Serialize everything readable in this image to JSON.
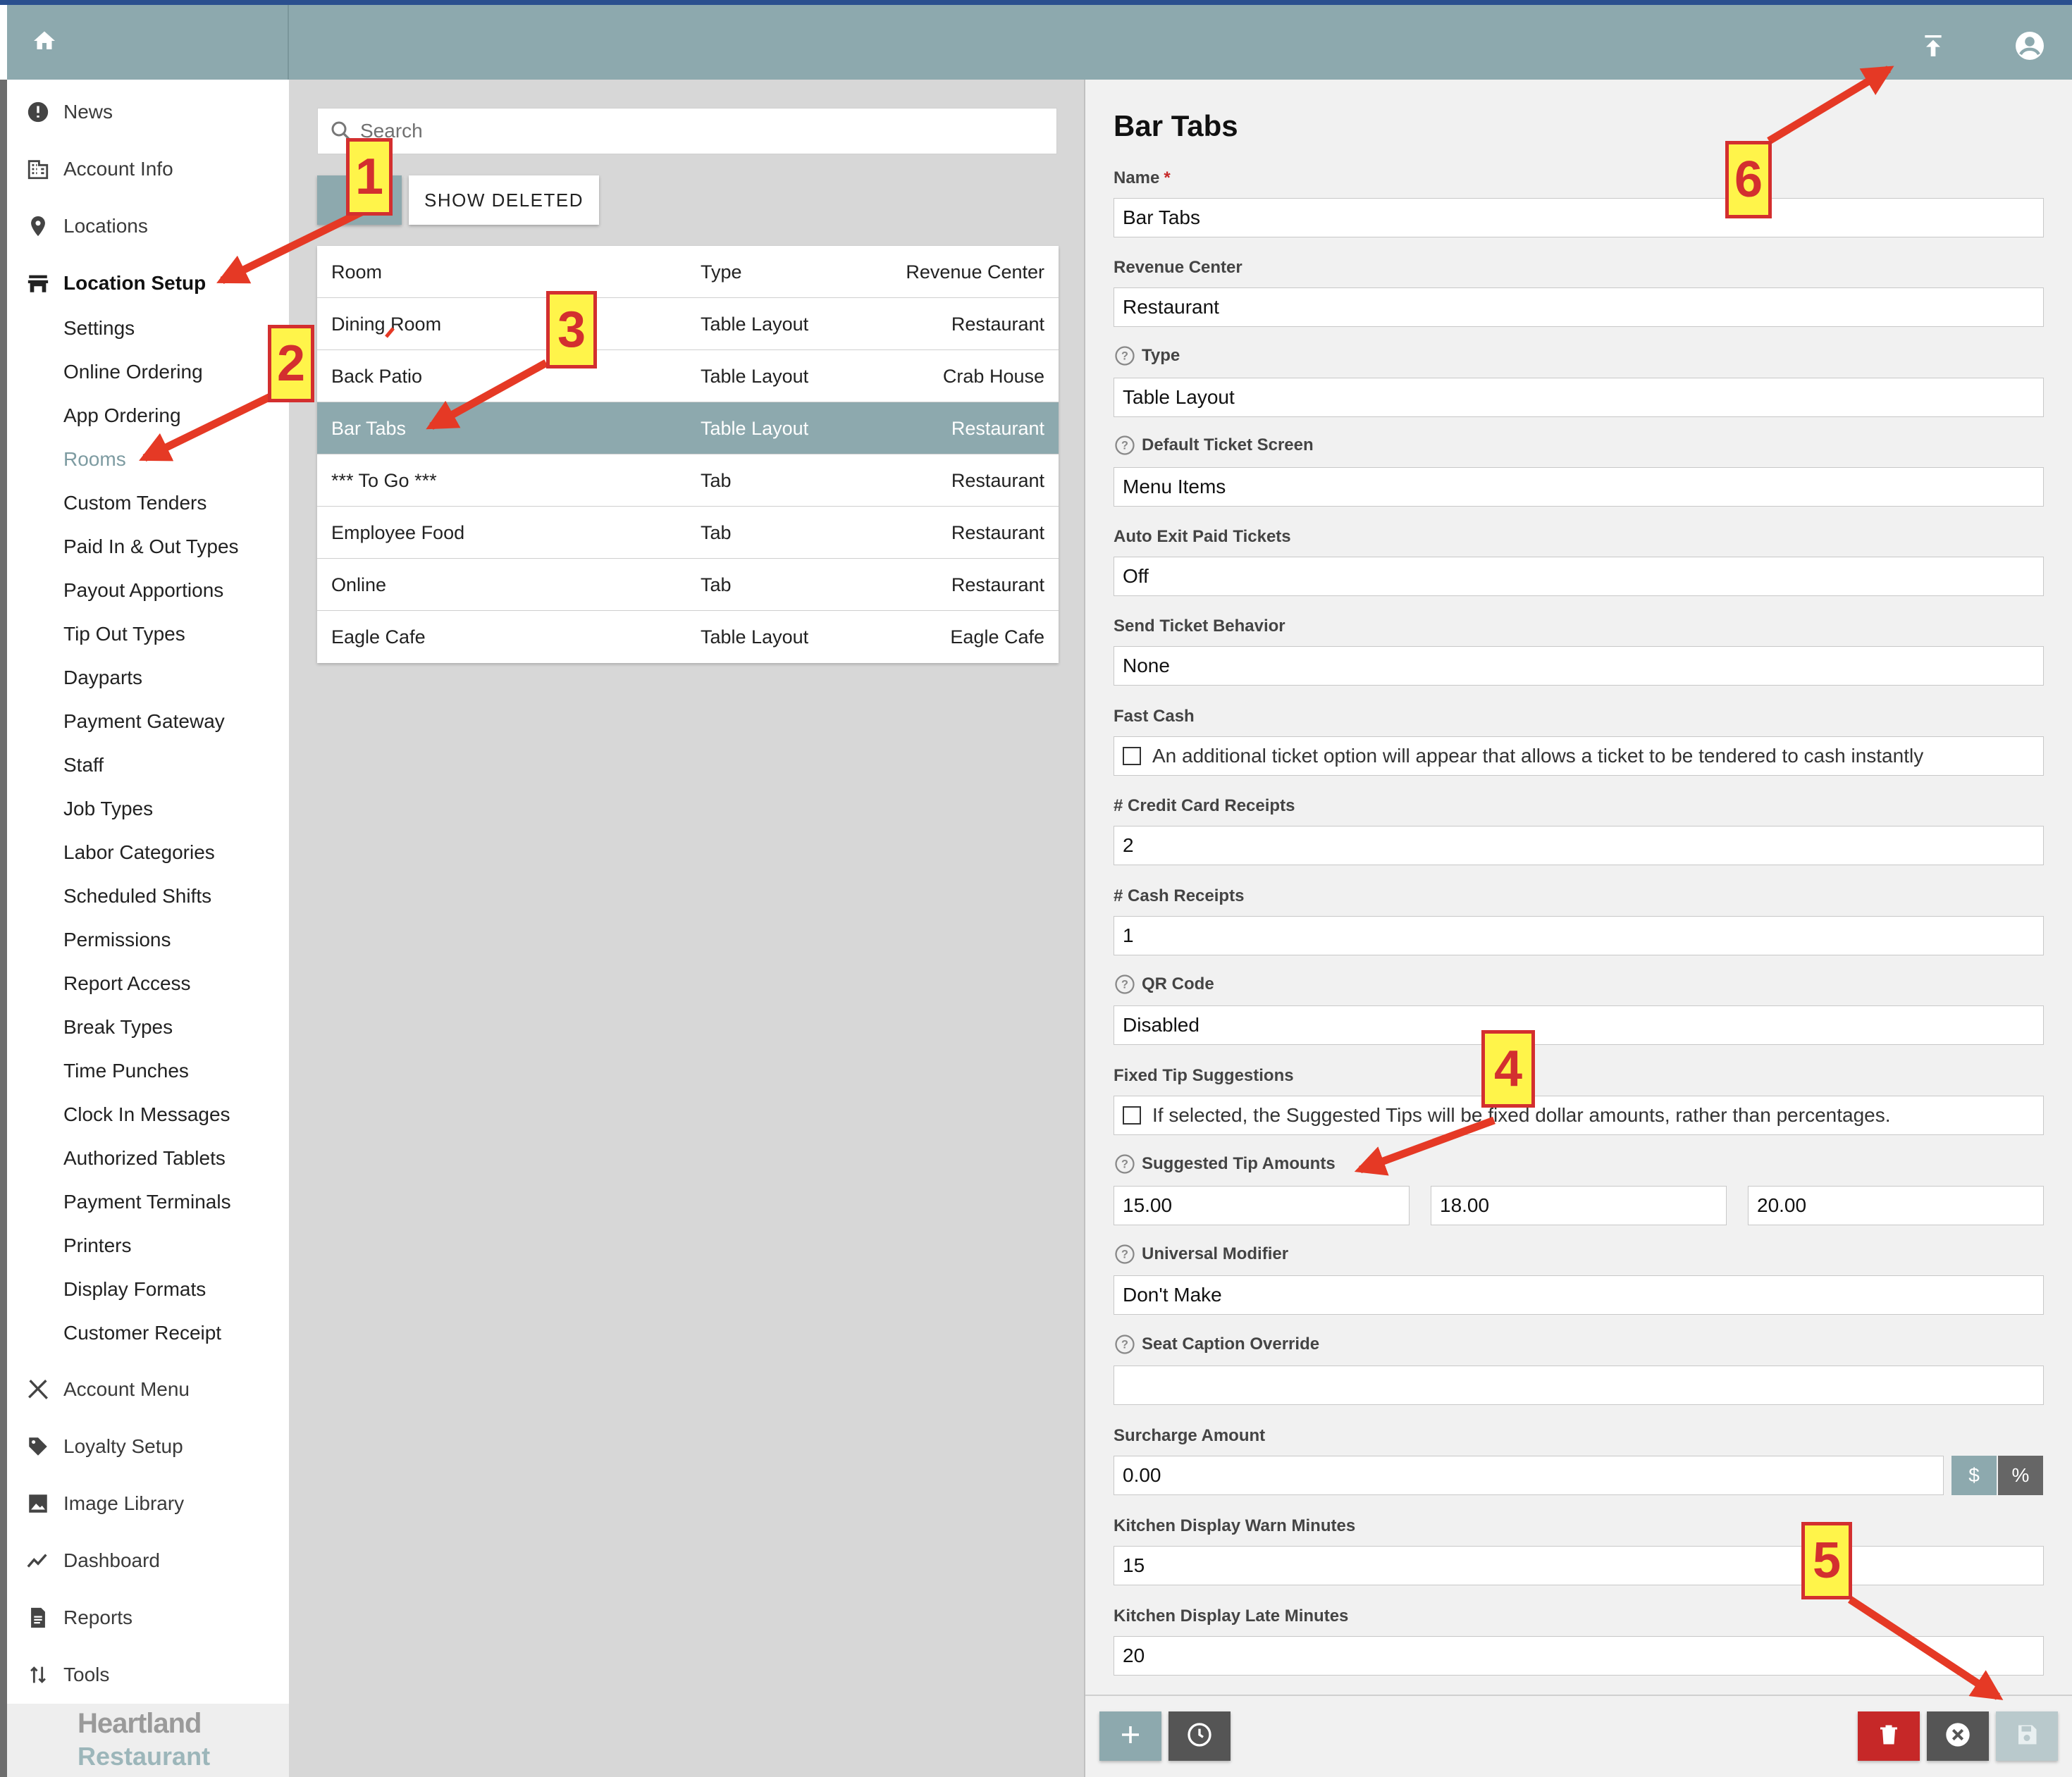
{
  "sidebar": {
    "items": [
      {
        "label": "News",
        "icon": "news-icon"
      },
      {
        "label": "Account Info",
        "icon": "building-icon"
      },
      {
        "label": "Locations",
        "icon": "location-pin-icon"
      },
      {
        "label": "Location Setup",
        "icon": "store-icon"
      }
    ],
    "sub_items": [
      "Settings",
      "Online Ordering",
      "App Ordering",
      "Rooms",
      "Custom Tenders",
      "Paid In & Out Types",
      "Payout Apportions",
      "Tip Out Types",
      "Dayparts",
      "Payment Gateway",
      "Staff",
      "Job Types",
      "Labor Categories",
      "Scheduled Shifts",
      "Permissions",
      "Report Access",
      "Break Types",
      "Time Punches",
      "Clock In Messages",
      "Authorized Tablets",
      "Payment Terminals",
      "Printers",
      "Display Formats",
      "Customer Receipt"
    ],
    "bottom_items": [
      {
        "label": "Account Menu",
        "icon": "fork-knife-icon"
      },
      {
        "label": "Loyalty Setup",
        "icon": "tag-icon"
      },
      {
        "label": "Image Library",
        "icon": "image-icon"
      },
      {
        "label": "Dashboard",
        "icon": "trend-line-icon"
      },
      {
        "label": "Reports",
        "icon": "report-icon"
      },
      {
        "label": "Tools",
        "icon": "sort-arrows-icon"
      }
    ],
    "logo_line1": "Heartland",
    "logo_line2": "Restaurant"
  },
  "middle": {
    "search_placeholder": "Search",
    "new_button": "N",
    "show_deleted_button": "SHOW DELETED",
    "columns": [
      "Room",
      "Type",
      "Revenue Center"
    ],
    "rows": [
      [
        "Dining Room",
        "Table Layout",
        "Restaurant"
      ],
      [
        "Back Patio",
        "Table Layout",
        "Crab House"
      ],
      [
        "Bar Tabs",
        "Table Layout",
        "Restaurant"
      ],
      [
        "*** To Go ***",
        "Tab",
        "Restaurant"
      ],
      [
        "Employee Food",
        "Tab",
        "Restaurant"
      ],
      [
        "Online",
        "Tab",
        "Restaurant"
      ],
      [
        "Eagle Cafe",
        "Table Layout",
        "Eagle Cafe"
      ]
    ],
    "selected_row": 2
  },
  "form": {
    "title": "Bar Tabs",
    "name_label": "Name",
    "name_required": "*",
    "name_value": "Bar Tabs",
    "revenue_center_label": "Revenue Center",
    "revenue_center_value": "Restaurant",
    "type_label": "Type",
    "type_value": "Table Layout",
    "default_ticket_screen_label": "Default Ticket Screen",
    "default_ticket_screen_value": "Menu Items",
    "auto_exit_label": "Auto Exit Paid Tickets",
    "auto_exit_value": "Off",
    "send_ticket_label": "Send Ticket Behavior",
    "send_ticket_value": "None",
    "fast_cash_label": "Fast Cash",
    "fast_cash_text": "An additional ticket option will appear that allows a ticket to be tendered to cash instantly",
    "cc_receipts_label": "# Credit Card Receipts",
    "cc_receipts_value": "2",
    "cash_receipts_label": "# Cash Receipts",
    "cash_receipts_value": "1",
    "qr_label": "QR Code",
    "qr_value": "Disabled",
    "fixed_tip_label": "Fixed Tip Suggestions",
    "fixed_tip_text": "If selected, the Suggested Tips will be fixed dollar amounts, rather than percentages.",
    "suggested_tips_label": "Suggested Tip Amounts",
    "tip1": "15.00",
    "tip2": "18.00",
    "tip3": "20.00",
    "universal_modifier_label": "Universal Modifier",
    "universal_modifier_value": "Don't Make",
    "seat_caption_label": "Seat Caption Override",
    "seat_caption_value": "",
    "surcharge_label": "Surcharge Amount",
    "surcharge_value": "0.00",
    "surcharge_dollar": "$",
    "surcharge_percent": "%",
    "warn_minutes_label": "Kitchen Display Warn Minutes",
    "warn_minutes_value": "15",
    "late_minutes_label": "Kitchen Display Late Minutes",
    "late_minutes_value": "20"
  },
  "callouts": [
    "1",
    "2",
    "3",
    "4",
    "5",
    "6"
  ],
  "colors": {
    "accent": "#8da9ae",
    "callout_fill": "#fff44a",
    "callout_border": "#d32f2f",
    "delete_red": "#c62828",
    "dark_button": "#555555"
  }
}
